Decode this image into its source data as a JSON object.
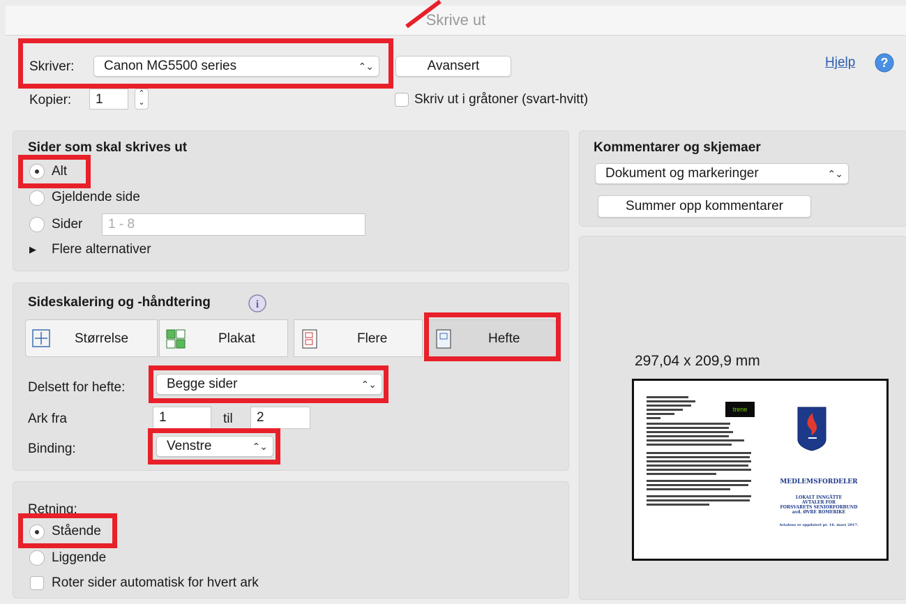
{
  "window": {
    "title": "Skrive ut"
  },
  "header": {
    "printer_label": "Skriver:",
    "printer_value": "Canon MG5500 series",
    "advanced_button": "Avansert",
    "help_link": "Hjelp",
    "copies_label": "Kopier:",
    "copies_value": "1",
    "grayscale_label": "Skriv ut i gråtoner (svart-hvitt)"
  },
  "pages": {
    "title": "Sider som skal skrives ut",
    "options": [
      "Alt",
      "Gjeldende side",
      "Sider"
    ],
    "selected": "Alt",
    "range_placeholder": "1 - 8",
    "more_options": "Flere alternativer"
  },
  "scaling": {
    "title": "Sideskalering og -håndtering",
    "modes": [
      "Størrelse",
      "Plakat",
      "Flere",
      "Hefte"
    ],
    "active_mode": "Hefte",
    "subset_label": "Delsett for hefte:",
    "subset_value": "Begge sider",
    "sheets_label": "Ark fra",
    "sheets_from": "1",
    "sheets_to_label": "til",
    "sheets_to": "2",
    "binding_label": "Binding:",
    "binding_value": "Venstre"
  },
  "orientation": {
    "title": "Retning:",
    "options": [
      "Stående",
      "Liggende"
    ],
    "selected": "Stående",
    "auto_rotate_label": "Roter sider automatisk for hvert ark"
  },
  "comments": {
    "title": "Kommentarer og skjemaer",
    "value": "Dokument og markeringer",
    "summarize_button": "Summer opp kommentarer"
  },
  "preview": {
    "size_label": "297,04 x 209,9 mm",
    "doc_green_tag": "trene",
    "doc_heading": "MEDLEMSFORDELER",
    "doc_sub1": "LOKALT INNGÅTTE",
    "doc_sub2": "AVTALER FOR",
    "doc_sub3": "FORSVARETS SENIORFORBUND",
    "doc_sub4": "avd. ØVRE ROMERIKE",
    "doc_footer": "Avtalene er oppdatert pr. 16. mars 2017."
  },
  "colors": {
    "highlight": "#e8202a",
    "link": "#2a5db0",
    "help_icon": "#4a90e2"
  }
}
